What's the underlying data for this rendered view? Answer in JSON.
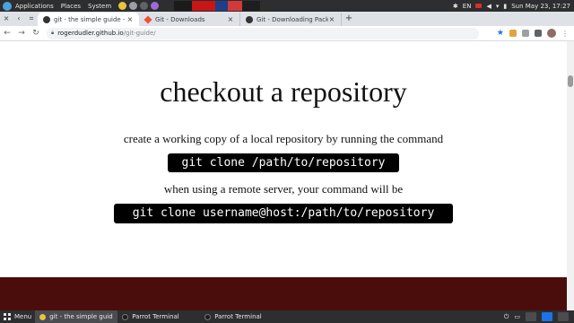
{
  "system_panel": {
    "menus": [
      "Applications",
      "Places",
      "System"
    ],
    "status": {
      "language": "EN",
      "datetime": "Sun May 23, 17:27"
    }
  },
  "tabs": [
    {
      "title": "git - the simple guide - no",
      "favicon": "github-icon",
      "active": true
    },
    {
      "title": "Git - Downloads",
      "favicon": "git-icon",
      "active": false
    },
    {
      "title": "Git - Downloading Package",
      "favicon": "github-icon",
      "active": false
    }
  ],
  "toolbar": {
    "url_host": "rogerdudler.github.io",
    "url_path": "/git-guide/"
  },
  "page": {
    "title": "checkout a repository",
    "para1": "create a working copy of a local repository by running the command",
    "code1": "git clone /path/to/repository",
    "para2": "when using a remote server, your command will be",
    "code2": "git clone username@host:/path/to/repository",
    "footer_color": "#4b0d0b"
  },
  "taskbar": {
    "menu_label": "Menu",
    "tasks": [
      {
        "label": "git - the simple guide - ...",
        "icon": "chrome-icon",
        "active": true
      },
      {
        "label": "Parrot Terminal",
        "icon": "terminal-icon",
        "active": false
      },
      {
        "label": "Parrot Terminal",
        "icon": "terminal-icon",
        "active": false
      }
    ]
  },
  "colors": {
    "accent": "#1a73e8",
    "panel": "#2d2e30",
    "code_bg": "#000000"
  }
}
